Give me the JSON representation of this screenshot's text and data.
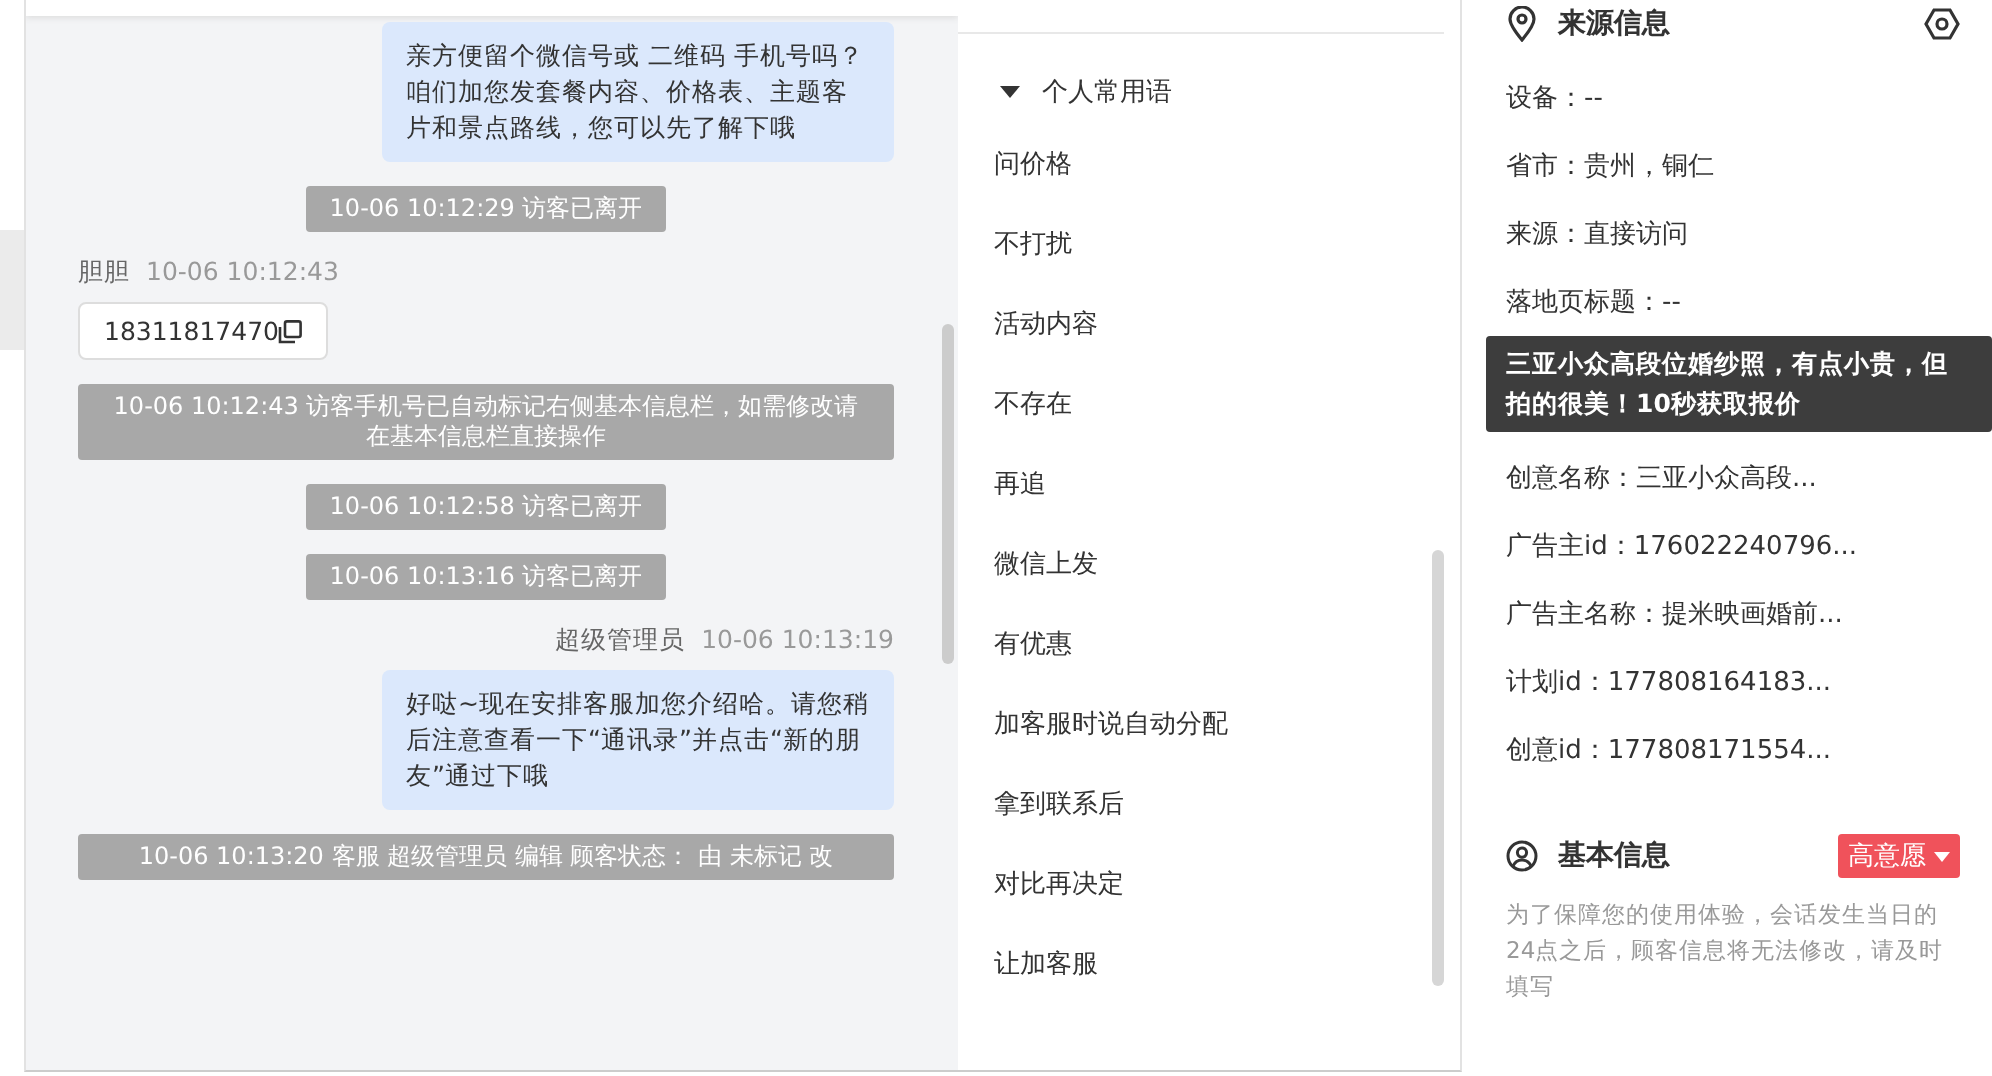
{
  "chat": {
    "messages": [
      {
        "kind": "agent",
        "text": "亲方便留个微信号或 二维码 手机号吗？咱们加您发套餐内容、价格表、主题客片和景点路线，您可以先了解下哦"
      },
      {
        "kind": "system",
        "text": "10-06 10:12:29 访客已离开"
      },
      {
        "kind": "visitor",
        "sender": "胆胆",
        "time": "10-06 10:12:43",
        "text": "18311817470"
      },
      {
        "kind": "system",
        "text": "10-06 10:12:43 访客手机号已自动标记右侧基本信息栏，如需修改请在基本信息栏直接操作"
      },
      {
        "kind": "system",
        "text": "10-06 10:12:58 访客已离开"
      },
      {
        "kind": "system",
        "text": "10-06 10:13:16 访客已离开"
      },
      {
        "kind": "agent",
        "sender": "超级管理员",
        "time": "10-06 10:13:19",
        "text": "好哒~现在安排客服加您介绍哈。请您稍后注意查看一下“通讯录”并点击“新的朋友”通过下哦"
      },
      {
        "kind": "system",
        "text": "10-06 10:13:20 客服 超级管理员 编辑 顾客状态： 由 未标记 改"
      }
    ]
  },
  "phrases": {
    "group": {
      "label": "个人常用语",
      "expanded": true
    },
    "items": [
      "问价格",
      "不打扰",
      "活动内容",
      "不存在",
      "再追",
      "微信上发",
      "有优惠",
      "加客服时说自动分配",
      "拿到联系后",
      "对比再决定",
      "让加客服"
    ]
  },
  "source_info": {
    "title": "来源信息",
    "rows": [
      {
        "kind": "field",
        "label": "设备：",
        "value": "--"
      },
      {
        "kind": "field",
        "label": "省市：",
        "value": "贵州，铜仁"
      },
      {
        "kind": "field",
        "label": "来源：",
        "value": "直接访问"
      },
      {
        "kind": "field",
        "label": "落地页标题：",
        "value": "--"
      },
      {
        "kind": "tooltip",
        "text": "三亚小众高段位婚纱照，有点小贵，但拍的很美！10秒获取报价"
      },
      {
        "kind": "field",
        "label": "创意名称：",
        "value": "三亚小众高段..."
      },
      {
        "kind": "field",
        "label": "广告主id：",
        "value": "176022240796..."
      },
      {
        "kind": "field",
        "label": "广告主名称：",
        "value": "提米映画婚前..."
      },
      {
        "kind": "field",
        "label": "计划id：",
        "value": "177808164183..."
      },
      {
        "kind": "field",
        "label": "创意id：",
        "value": "177808171554..."
      }
    ]
  },
  "basic_info": {
    "title": "基本信息",
    "intent_tag": "高意愿",
    "notice": "为了保障您的使用体验，会话发生当日的24点之后，顾客信息将无法修改，请及时填写"
  }
}
